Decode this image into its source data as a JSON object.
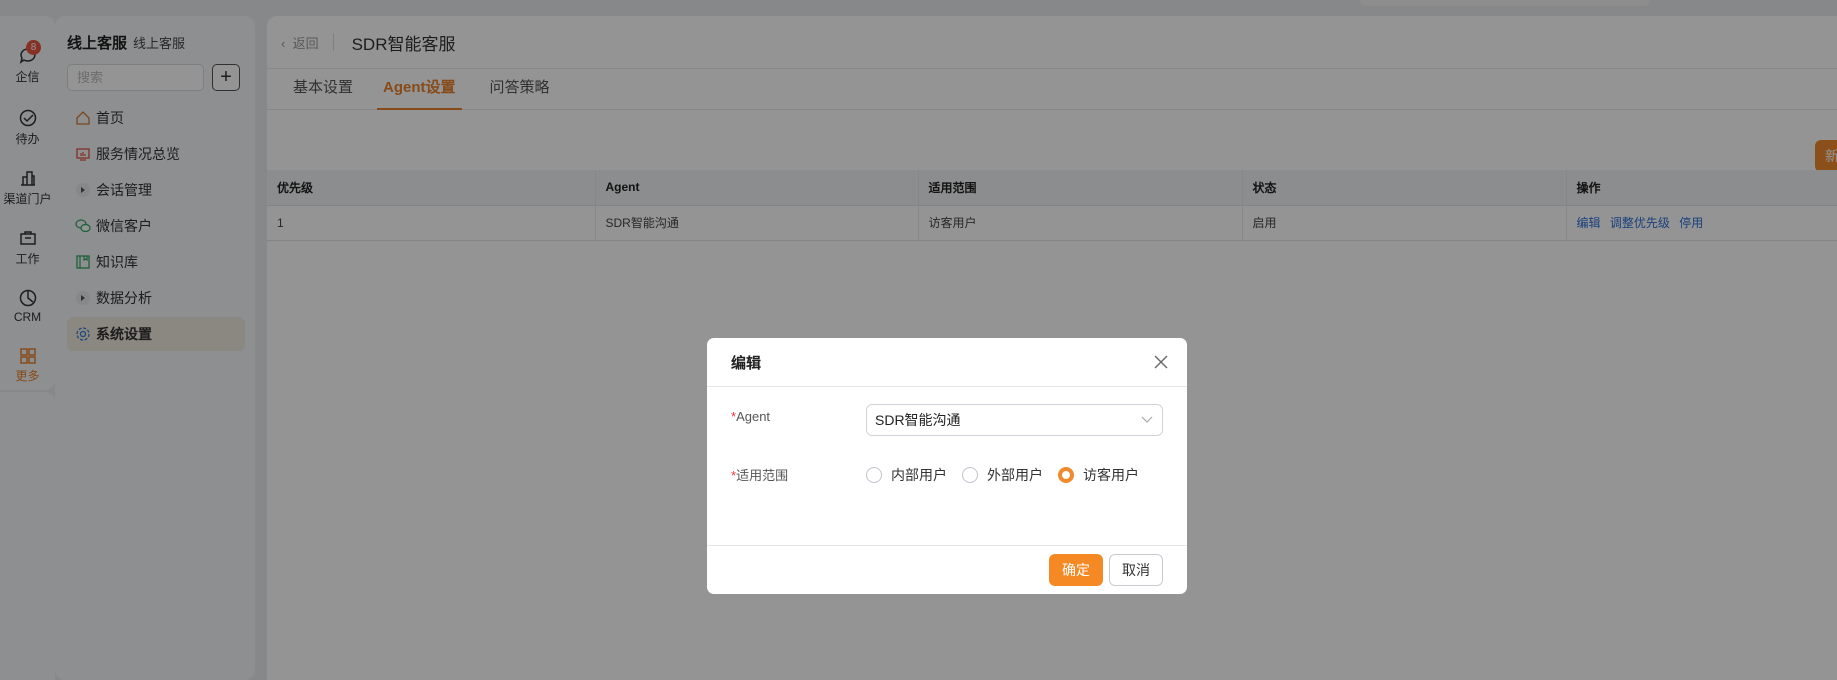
{
  "rail": {
    "items": [
      {
        "label": "企信",
        "badge": "8"
      },
      {
        "label": "待办"
      },
      {
        "label": "渠道门户"
      },
      {
        "label": "工作"
      },
      {
        "label": "CRM"
      },
      {
        "label": "更多"
      }
    ]
  },
  "sidebar": {
    "title": "线上客服",
    "subtitle": "线上客服",
    "search_placeholder": "搜索",
    "add_label": "+",
    "items": [
      {
        "label": "首页"
      },
      {
        "label": "服务情况总览"
      },
      {
        "label": "会话管理"
      },
      {
        "label": "微信客户"
      },
      {
        "label": "知识库"
      },
      {
        "label": "数据分析"
      },
      {
        "label": "系统设置"
      }
    ]
  },
  "header": {
    "back": "返回",
    "title": "SDR智能客服"
  },
  "tabs": [
    {
      "label": "基本设置"
    },
    {
      "label": "Agent设置"
    },
    {
      "label": "问答策略"
    }
  ],
  "toolbar": {
    "new_label": "新"
  },
  "table": {
    "headers": [
      "优先级",
      "Agent",
      "适用范围",
      "状态",
      "操作"
    ],
    "rows": [
      {
        "priority": "1",
        "agent": "SDR智能沟通",
        "scope": "访客用户",
        "status": "启用",
        "actions": [
          "编辑",
          "调整优先级",
          "停用"
        ]
      }
    ]
  },
  "modal": {
    "title": "编辑",
    "agent_label": "Agent",
    "agent_value": "SDR智能沟通",
    "scope_label": "适用范围",
    "required_mark": "*",
    "scope_options": [
      "内部用户",
      "外部用户",
      "访客用户"
    ],
    "scope_selected": "访客用户",
    "ok": "确定",
    "cancel": "取消"
  },
  "colors": {
    "accent": "#f08a2c",
    "link": "#2f6fd6"
  }
}
